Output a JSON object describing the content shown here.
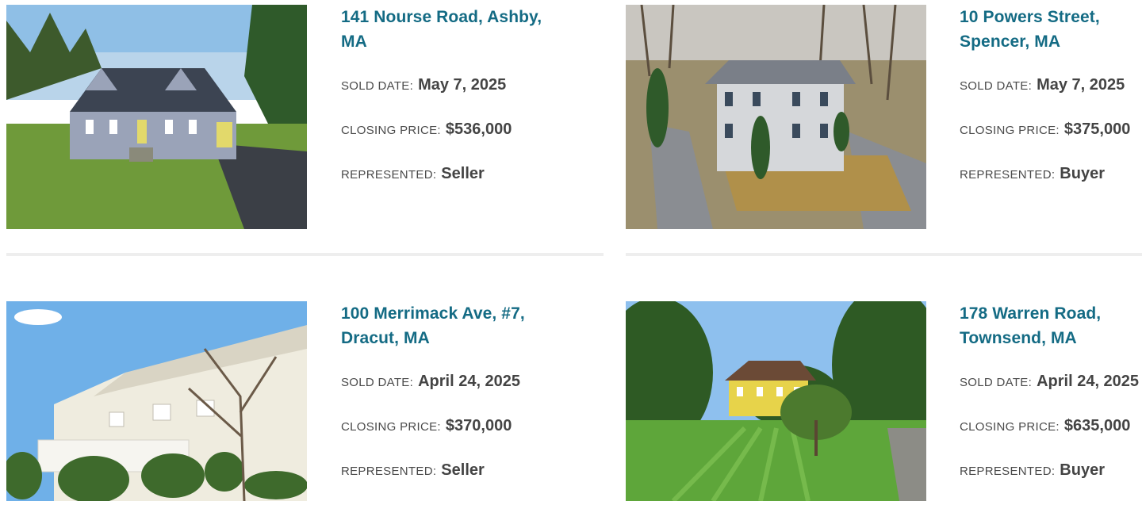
{
  "labels": {
    "sold_date": "SOLD DATE:",
    "closing_price": "CLOSING PRICE:",
    "represented": "REPRESENTED:"
  },
  "listings": [
    {
      "address": "141 Nourse Road, Ashby,\nMA",
      "sold_date": "May 7, 2025",
      "closing_price": "$536,000",
      "represented": "Seller",
      "photo_icon": "house-photo"
    },
    {
      "address": "10 Powers Street,\nSpencer, MA",
      "sold_date": "May 7, 2025",
      "closing_price": "$375,000",
      "represented": "Buyer",
      "photo_icon": "house-photo"
    },
    {
      "address": "100 Merrimack Ave, #7,\nDracut, MA",
      "sold_date": "April 24, 2025",
      "closing_price": "$370,000",
      "represented": "Seller",
      "photo_icon": "condo-photo"
    },
    {
      "address": "178 Warren Road,\nTownsend, MA",
      "sold_date": "April 24, 2025",
      "closing_price": "$635,000",
      "represented": "Buyer",
      "photo_icon": "house-photo"
    }
  ],
  "colors": {
    "address": "#146b84",
    "text": "#4a4a4a",
    "divider": "#eeeeee"
  }
}
